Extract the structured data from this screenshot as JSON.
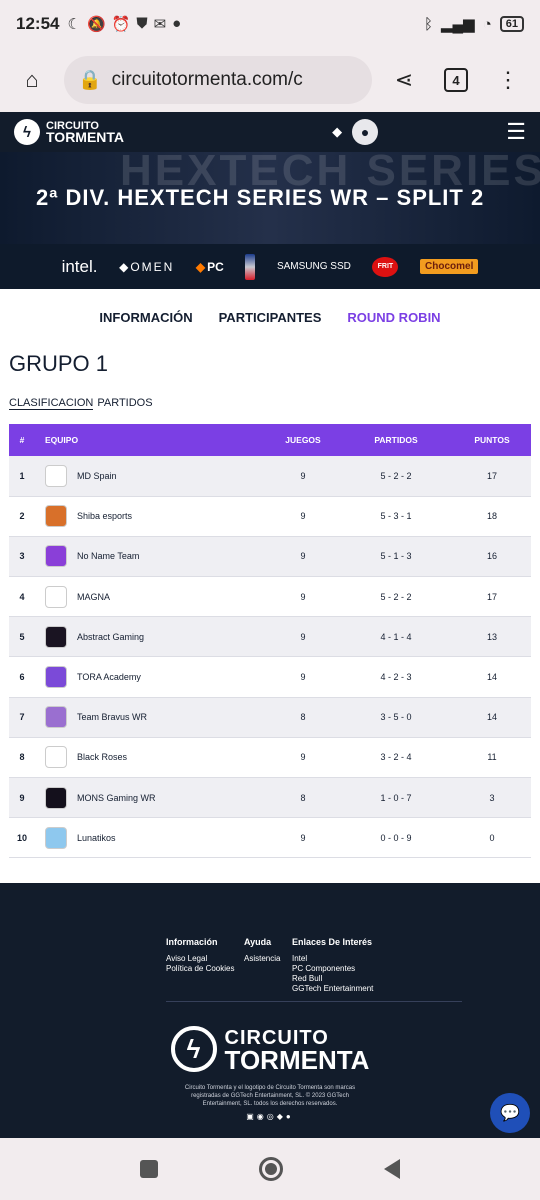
{
  "status": {
    "time": "12:54",
    "battery": "61"
  },
  "browser": {
    "url": "circuitotormenta.com/c",
    "tab_count": "4"
  },
  "site": {
    "logo_line1": "CIRCUITO",
    "logo_line2": "TORMENTA"
  },
  "banner": {
    "bg_text": "HEXTECH SERIES",
    "title": "2ª DIV. HEXTECH SERIES WR – SPLIT 2"
  },
  "sponsors": {
    "intel": "intel.",
    "omen": "OMEN",
    "pc": "PC",
    "samsung": "SAMSUNG SSD",
    "frit": "FRIT",
    "chocomel": "Chocomel"
  },
  "tabs": {
    "informacion": "INFORMACIÓN",
    "participantes": "PARTICIPANTES",
    "round_robin": "ROUND ROBIN"
  },
  "group": {
    "title": "GRUPO 1",
    "subtab_clasificacion": "CLASIFICACION",
    "subtab_partidos": "PARTIDOS"
  },
  "table": {
    "headers": {
      "num": "#",
      "equipo": "EQUIPO",
      "juegos": "JUEGOS",
      "partidos": "PARTIDOS",
      "puntos": "PUNTOS"
    },
    "rows": [
      {
        "pos": "1",
        "team": "MD Spain",
        "juegos": "9",
        "partidos": "5 - 2 - 2",
        "puntos": "17",
        "color": "#ffffff"
      },
      {
        "pos": "2",
        "team": "Shiba esports",
        "juegos": "9",
        "partidos": "5 - 3 - 1",
        "puntos": "18",
        "color": "#d8702a"
      },
      {
        "pos": "3",
        "team": "No Name Team",
        "juegos": "9",
        "partidos": "5 - 1 - 3",
        "puntos": "16",
        "color": "#8a3fd8"
      },
      {
        "pos": "4",
        "team": "MAGNA",
        "juegos": "9",
        "partidos": "5 - 2 - 2",
        "puntos": "17",
        "color": "#ffffff"
      },
      {
        "pos": "5",
        "team": "Abstract Gaming",
        "juegos": "9",
        "partidos": "4 - 1 - 4",
        "puntos": "13",
        "color": "#1a1422"
      },
      {
        "pos": "6",
        "team": "TORA Academy",
        "juegos": "9",
        "partidos": "4 - 2 - 3",
        "puntos": "14",
        "color": "#7b4ad8"
      },
      {
        "pos": "7",
        "team": "Team Bravus WR",
        "juegos": "8",
        "partidos": "3 - 5 - 0",
        "puntos": "14",
        "color": "#9a6fd0"
      },
      {
        "pos": "8",
        "team": "Black Roses",
        "juegos": "9",
        "partidos": "3 - 2 - 4",
        "puntos": "11",
        "color": "#ffffff"
      },
      {
        "pos": "9",
        "team": "MONS Gaming WR",
        "juegos": "8",
        "partidos": "1 - 0 - 7",
        "puntos": "3",
        "color": "#14101c"
      },
      {
        "pos": "10",
        "team": "Lunatikos",
        "juegos": "9",
        "partidos": "0 - 0 - 9",
        "puntos": "0",
        "color": "#8ec8ee"
      }
    ]
  },
  "footer": {
    "col1": {
      "title": "Información",
      "links": [
        "Aviso Legal",
        "Política de Cookies"
      ]
    },
    "col2": {
      "title": "Ayuda",
      "links": [
        "Asistencia"
      ]
    },
    "col3": {
      "title": "Enlaces De Interés",
      "links": [
        "Intel",
        "PC Componentes",
        "Red Bull",
        "GGTech Entertainment"
      ]
    },
    "logo_line1": "CIRCUITO",
    "logo_line2": "TORMENTA",
    "copyright": "Circuito Tormenta y el logotipo de Circuito Tormenta son marcas registradas de GGTech Entertainment, SL. © 2023 GGTech Entertainment, SL. todos los derechos reservados."
  },
  "colors": {
    "accent": "#7b3fe4",
    "dark": "#121c2b"
  }
}
